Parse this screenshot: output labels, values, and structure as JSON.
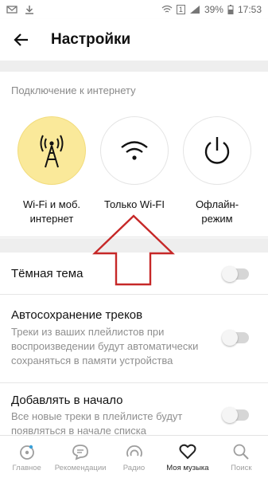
{
  "status_bar": {
    "battery": "39%",
    "time": "17:53",
    "notification_count": "1"
  },
  "header": {
    "title": "Настройки"
  },
  "connection": {
    "title": "Подключение к интернету",
    "options": [
      {
        "label_line1": "Wi-Fi и моб.",
        "label_line2": "интернет",
        "icon": "cell-tower-icon",
        "selected": true
      },
      {
        "label_line1": "Только Wi-FI",
        "label_line2": "",
        "icon": "wifi-icon",
        "selected": false
      },
      {
        "label_line1": "Офлайн-",
        "label_line2": "режим",
        "icon": "power-icon",
        "selected": false
      }
    ]
  },
  "settings": [
    {
      "title": "Тёмная тема",
      "description": "",
      "enabled": false
    },
    {
      "title": "Автосохранение треков",
      "description": "Треки из ваших плейлистов при воспроизведении будут автоматически сохраняться в памяти устройства",
      "enabled": false
    },
    {
      "title": "Добавлять в начало",
      "description": "Все новые треки в плейлисте будут появляться в начале списка",
      "enabled": false
    }
  ],
  "bottom_nav": [
    {
      "label": "Главное",
      "icon": "home-icon",
      "active": false
    },
    {
      "label": "Рекомендации",
      "icon": "chat-bubble-icon",
      "active": false
    },
    {
      "label": "Радио",
      "icon": "radio-icon",
      "active": false
    },
    {
      "label": "Моя музыка",
      "icon": "heart-icon",
      "active": true
    },
    {
      "label": "Поиск",
      "icon": "search-icon",
      "active": false
    }
  ],
  "colors": {
    "accent_selected": "#fae99a",
    "arrow": "#c62828"
  }
}
